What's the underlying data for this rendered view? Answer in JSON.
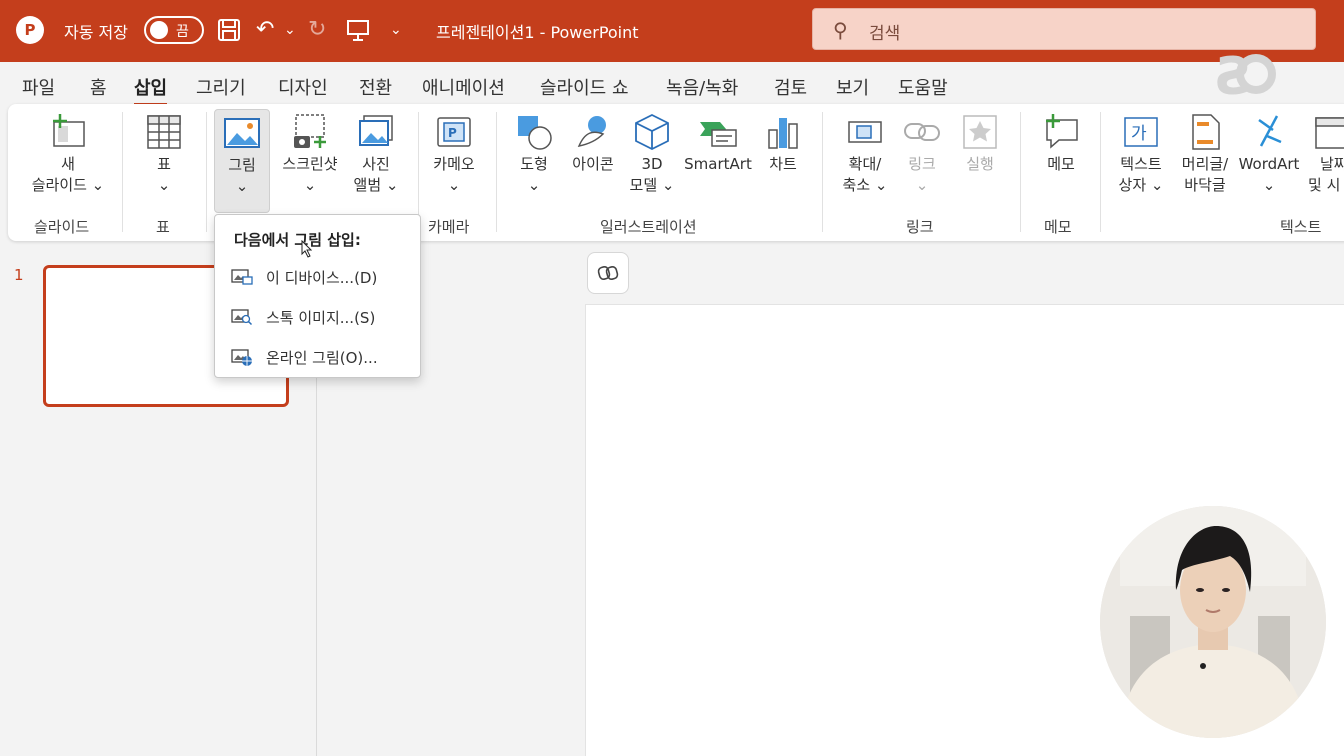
{
  "titlebar": {
    "autosave_label": "자동 저장",
    "autosave_state": "끔",
    "title": "프레젠테이션1  -  PowerPoint",
    "search_placeholder": "검색"
  },
  "tabs": [
    "파일",
    "홈",
    "삽입",
    "그리기",
    "디자인",
    "전환",
    "애니메이션",
    "슬라이드 쇼",
    "녹음/녹화",
    "검토",
    "보기",
    "도움말"
  ],
  "active_tab": "삽입",
  "ribbon": {
    "new_slide": [
      "새",
      "슬라이드 ⌄"
    ],
    "table": [
      "표",
      "⌄"
    ],
    "picture": [
      "그림",
      "⌄"
    ],
    "screenshot": [
      "스크린샷",
      "⌄"
    ],
    "photo_album": [
      "사진",
      "앨범 ⌄"
    ],
    "cameo": [
      "카메오",
      "⌄"
    ],
    "shapes": [
      "도형",
      "⌄"
    ],
    "icons": [
      "아이콘"
    ],
    "models3d": [
      "3D",
      "모델 ⌄"
    ],
    "smartart": [
      "SmartArt"
    ],
    "chart": [
      "차트"
    ],
    "zoom": [
      "확대/",
      "축소 ⌄"
    ],
    "link": [
      "링크",
      "⌄"
    ],
    "action": [
      "실행"
    ],
    "comment": [
      "메모"
    ],
    "textbox": [
      "텍스트",
      "상자 ⌄"
    ],
    "header_footer": [
      "머리글/",
      "바닥글"
    ],
    "wordart": [
      "WordArt",
      "⌄"
    ],
    "datetime": [
      "날짜",
      "및 시"
    ],
    "groups": {
      "slides": "슬라이드",
      "tables": "표",
      "camera": "카메라",
      "illustrations": "일러스트레이션",
      "links": "링크",
      "comments": "메모",
      "text": "텍스트"
    }
  },
  "dropdown": {
    "header": "다음에서 그림 삽입:",
    "items": [
      "이 디바이스...(D)",
      "스톡 이미지...(S)",
      "온라인 그림(O)..."
    ]
  },
  "slide_pane": {
    "slide_number": "1"
  },
  "colors": {
    "accent": "#c43e1c",
    "ribbon_bg": "#ffffff",
    "app_bg": "#f3f3f3"
  }
}
